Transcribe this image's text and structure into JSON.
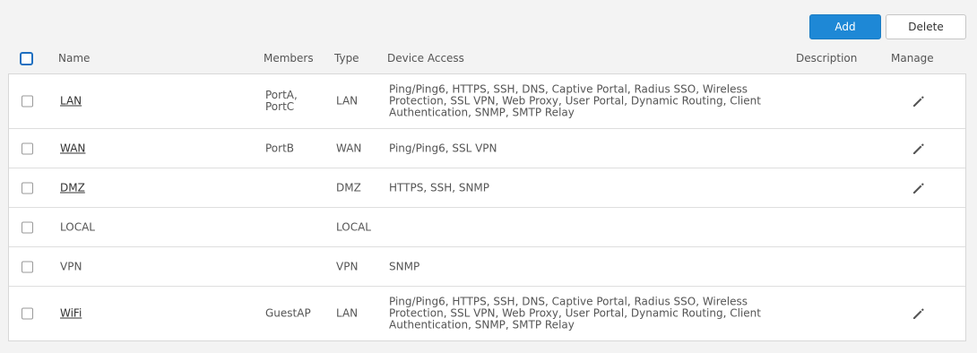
{
  "toolbar": {
    "add_label": "Add",
    "delete_label": "Delete"
  },
  "columns": {
    "name": "Name",
    "members": "Members",
    "type": "Type",
    "device_access": "Device Access",
    "description": "Description",
    "manage": "Manage"
  },
  "rows": [
    {
      "name": "LAN",
      "members": "PortA, PortC",
      "type": "LAN",
      "device_access": "Ping/Ping6, HTTPS, SSH, DNS, Captive Portal, Radius SSO, Wireless Protection, SSL VPN, Web Proxy, User Portal, Dynamic Routing, Client Authentication, SNMP, SMTP Relay",
      "description": "",
      "editable": true
    },
    {
      "name": "WAN",
      "members": "PortB",
      "type": "WAN",
      "device_access": "Ping/Ping6, SSL VPN",
      "description": "",
      "editable": true
    },
    {
      "name": "DMZ",
      "members": "",
      "type": "DMZ",
      "device_access": "HTTPS, SSH, SNMP",
      "description": "",
      "editable": true
    },
    {
      "name": "LOCAL",
      "members": "",
      "type": "LOCAL",
      "device_access": "",
      "description": "",
      "editable": false
    },
    {
      "name": "VPN",
      "members": "",
      "type": "VPN",
      "device_access": "SNMP",
      "description": "",
      "editable": false
    },
    {
      "name": "WiFi",
      "members": "GuestAP",
      "type": "LAN",
      "device_access": "Ping/Ping6, HTTPS, SSH, DNS, Captive Portal, Radius SSO, Wireless Protection, SSL VPN, Web Proxy, User Portal, Dynamic Routing, Client Authentication, SNMP, SMTP Relay",
      "description": "",
      "editable": true
    }
  ],
  "icons": {
    "edit": "pencil-icon"
  },
  "colors": {
    "accent": "#1e88d6"
  }
}
